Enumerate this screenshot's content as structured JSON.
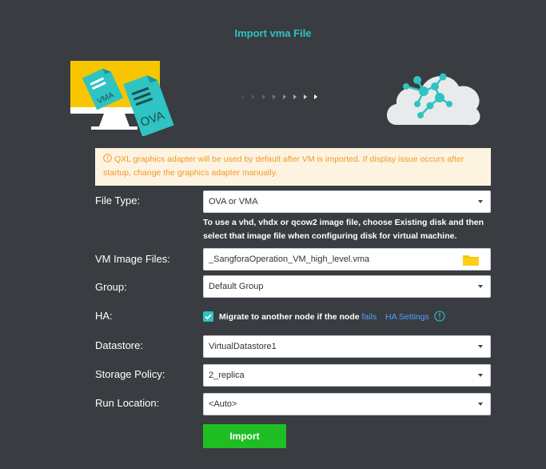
{
  "dialog": {
    "title": "Import vma File"
  },
  "notice": {
    "text": "QXL graphics adapter will be used by default after VM is imported. If display issue occurs after startup, change the graphics adapter manually."
  },
  "illustration": {
    "file_badge_1": "VMA",
    "file_badge_2": "OVA"
  },
  "form": {
    "file_type": {
      "label": "File Type:",
      "value": "OVA or VMA"
    },
    "hint": "To use a vhd, vhdx or qcow2 image file, choose Existing disk and then select that image file when configuring disk for virtual machine.",
    "image_files": {
      "label": "VM Image Files:",
      "value": "_SangforaOperation_VM_high_level.vma"
    },
    "group": {
      "label": "Group:",
      "value": "Default Group"
    },
    "ha": {
      "label": "HA:",
      "checked": true,
      "text": "Migrate to another node if the node",
      "link": "fails",
      "settings_link": "HA Settings"
    },
    "datastore": {
      "label": "Datastore:",
      "value": "VirtualDatastore1"
    },
    "storage_policy": {
      "label": "Storage Policy:",
      "value": "2_replica"
    },
    "run_location": {
      "label": "Run Location:",
      "value": "<Auto>"
    }
  },
  "actions": {
    "import_label": "Import"
  },
  "colors": {
    "accent": "#2fc3c3",
    "primary_button": "#1fbf24",
    "warning": "#f09a27",
    "link": "#4da6ff",
    "background": "#393c41"
  }
}
